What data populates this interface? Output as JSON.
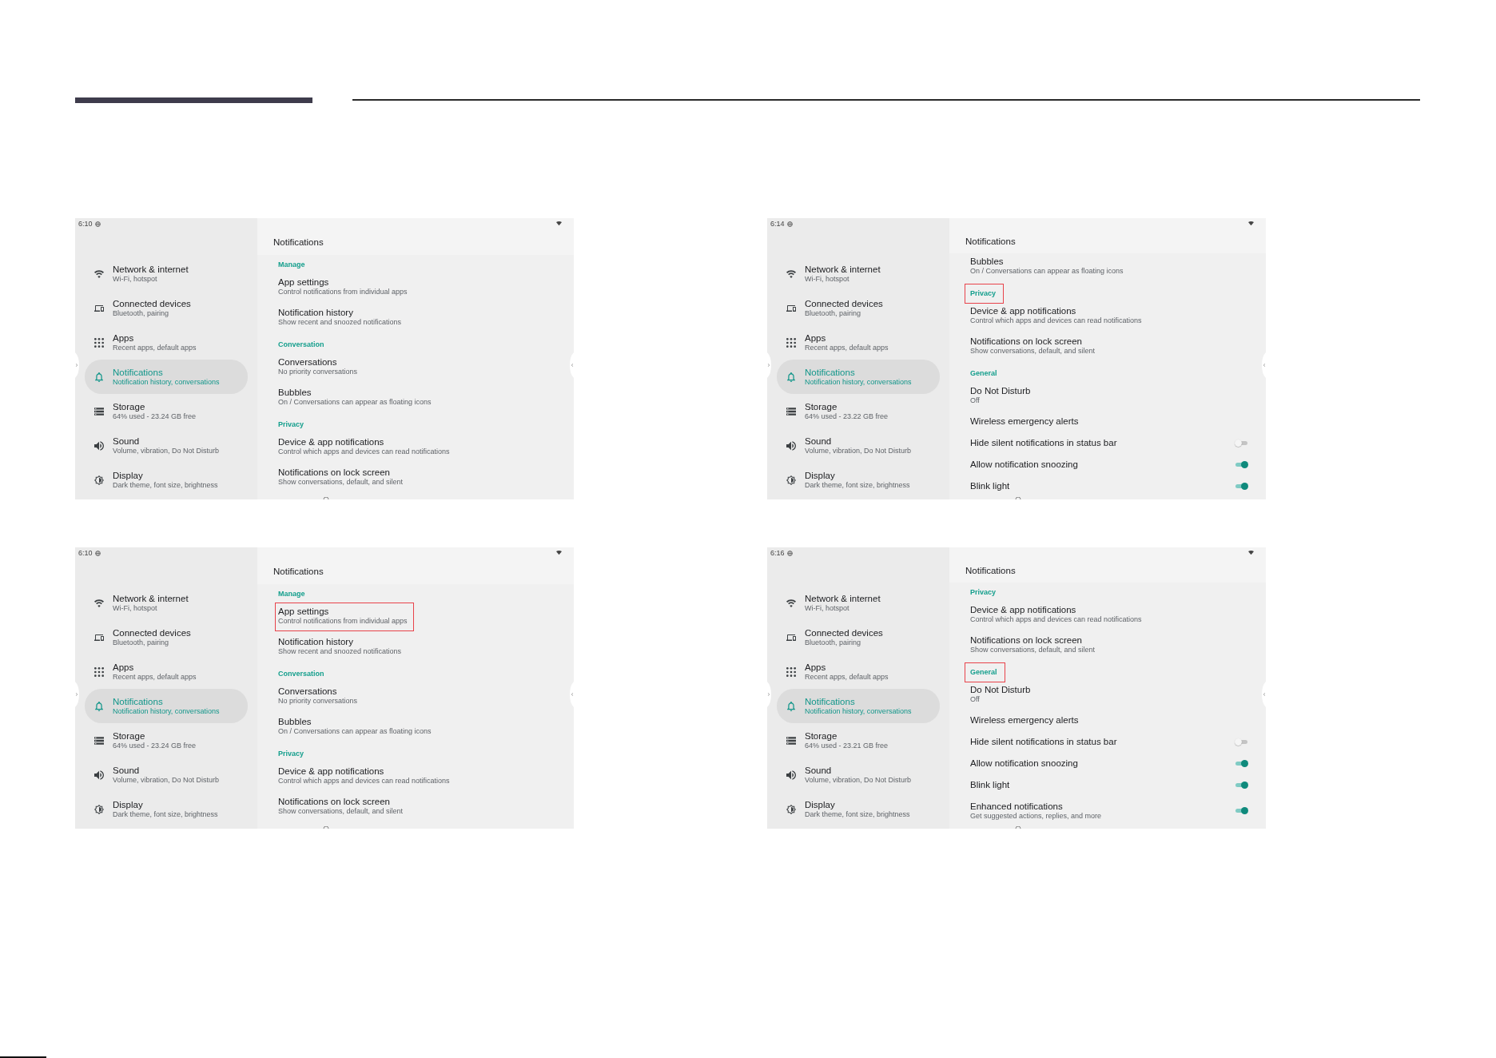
{
  "screens": [
    {
      "status_bar": {
        "time": "6:10"
      },
      "sidebar": {
        "items": [
          {
            "title": "Network & internet",
            "subtitle": "Wi-Fi, hotspot",
            "selected": false
          },
          {
            "title": "Connected devices",
            "subtitle": "Bluetooth, pairing",
            "selected": false
          },
          {
            "title": "Apps",
            "subtitle": "Recent apps, default apps",
            "selected": false
          },
          {
            "title": "Notifications",
            "subtitle": "Notification history, conversations",
            "selected": true
          },
          {
            "title": "Storage",
            "subtitle": "64% used - 23.24 GB free",
            "selected": false
          },
          {
            "title": "Sound",
            "subtitle": "Volume, vibration, Do Not Disturb",
            "selected": false
          },
          {
            "title": "Display",
            "subtitle": "Dark theme, font size, brightness",
            "selected": false
          }
        ]
      },
      "page": {
        "title": "Notifications",
        "rows": [
          {
            "kind": "section",
            "title": "Manage",
            "highlighted": false
          },
          {
            "kind": "item",
            "title": "App settings",
            "subtitle": "Control notifications from individual apps",
            "highlighted": false
          },
          {
            "kind": "item",
            "title": "Notification history",
            "subtitle": "Show recent and snoozed notifications",
            "highlighted": false
          },
          {
            "kind": "section",
            "title": "Conversation",
            "highlighted": false
          },
          {
            "kind": "item",
            "title": "Conversations",
            "subtitle": "No priority conversations",
            "highlighted": false
          },
          {
            "kind": "item",
            "title": "Bubbles",
            "subtitle": "On / Conversations can appear as floating icons",
            "highlighted": false
          },
          {
            "kind": "section",
            "title": "Privacy",
            "highlighted": false
          },
          {
            "kind": "item",
            "title": "Device & app notifications",
            "subtitle": "Control which apps and devices can read notifications",
            "highlighted": false
          },
          {
            "kind": "item",
            "title": "Notifications on lock screen",
            "subtitle": "Show conversations, default, and silent",
            "highlighted": false
          }
        ]
      }
    },
    {
      "status_bar": {
        "time": "6:14"
      },
      "sidebar": {
        "items": [
          {
            "title": "Network & internet",
            "subtitle": "Wi-Fi, hotspot",
            "selected": false
          },
          {
            "title": "Connected devices",
            "subtitle": "Bluetooth, pairing",
            "selected": false
          },
          {
            "title": "Apps",
            "subtitle": "Recent apps, default apps",
            "selected": false
          },
          {
            "title": "Notifications",
            "subtitle": "Notification history, conversations",
            "selected": true
          },
          {
            "title": "Storage",
            "subtitle": "64% used - 23.22 GB free",
            "selected": false
          },
          {
            "title": "Sound",
            "subtitle": "Volume, vibration, Do Not Disturb",
            "selected": false
          },
          {
            "title": "Display",
            "subtitle": "Dark theme, font size, brightness",
            "selected": false
          }
        ]
      },
      "page": {
        "title": "Notifications",
        "rows": [
          {
            "kind": "item",
            "title": "Bubbles",
            "subtitle": "On / Conversations can appear as floating icons",
            "highlighted": false
          },
          {
            "kind": "section",
            "title": "Privacy",
            "highlighted": true
          },
          {
            "kind": "item",
            "title": "Device & app notifications",
            "subtitle": "Control which apps and devices can read notifications",
            "highlighted": false
          },
          {
            "kind": "item",
            "title": "Notifications on lock screen",
            "subtitle": "Show conversations, default, and silent",
            "highlighted": false
          },
          {
            "kind": "section",
            "title": "General",
            "highlighted": false
          },
          {
            "kind": "item",
            "title": "Do Not Disturb",
            "subtitle": "Off",
            "highlighted": false
          },
          {
            "kind": "item",
            "title": "Wireless emergency alerts",
            "highlighted": false
          },
          {
            "kind": "switch",
            "title": "Hide silent notifications in status bar",
            "on": false,
            "highlighted": false
          },
          {
            "kind": "switch",
            "title": "Allow notification snoozing",
            "on": true,
            "highlighted": false
          },
          {
            "kind": "switch",
            "title": "Blink light",
            "on": true,
            "highlighted": false
          }
        ]
      }
    },
    {
      "status_bar": {
        "time": "6:10"
      },
      "sidebar": {
        "items": [
          {
            "title": "Network & internet",
            "subtitle": "Wi-Fi, hotspot",
            "selected": false
          },
          {
            "title": "Connected devices",
            "subtitle": "Bluetooth, pairing",
            "selected": false
          },
          {
            "title": "Apps",
            "subtitle": "Recent apps, default apps",
            "selected": false
          },
          {
            "title": "Notifications",
            "subtitle": "Notification history, conversations",
            "selected": true
          },
          {
            "title": "Storage",
            "subtitle": "64% used - 23.24 GB free",
            "selected": false
          },
          {
            "title": "Sound",
            "subtitle": "Volume, vibration, Do Not Disturb",
            "selected": false
          },
          {
            "title": "Display",
            "subtitle": "Dark theme, font size, brightness",
            "selected": false
          }
        ]
      },
      "page": {
        "title": "Notifications",
        "rows": [
          {
            "kind": "section",
            "title": "Manage",
            "highlighted": false
          },
          {
            "kind": "item",
            "title": "App settings",
            "subtitle": "Control notifications from individual apps",
            "highlighted": true
          },
          {
            "kind": "item",
            "title": "Notification history",
            "subtitle": "Show recent and snoozed notifications",
            "highlighted": false
          },
          {
            "kind": "section",
            "title": "Conversation",
            "highlighted": false
          },
          {
            "kind": "item",
            "title": "Conversations",
            "subtitle": "No priority conversations",
            "highlighted": false
          },
          {
            "kind": "item",
            "title": "Bubbles",
            "subtitle": "On / Conversations can appear as floating icons",
            "highlighted": false
          },
          {
            "kind": "section",
            "title": "Privacy",
            "highlighted": false
          },
          {
            "kind": "item",
            "title": "Device & app notifications",
            "subtitle": "Control which apps and devices can read notifications",
            "highlighted": false
          },
          {
            "kind": "item",
            "title": "Notifications on lock screen",
            "subtitle": "Show conversations, default, and silent",
            "highlighted": false
          }
        ]
      }
    },
    {
      "status_bar": {
        "time": "6:16"
      },
      "sidebar": {
        "items": [
          {
            "title": "Network & internet",
            "subtitle": "Wi-Fi, hotspot",
            "selected": false
          },
          {
            "title": "Connected devices",
            "subtitle": "Bluetooth, pairing",
            "selected": false
          },
          {
            "title": "Apps",
            "subtitle": "Recent apps, default apps",
            "selected": false
          },
          {
            "title": "Notifications",
            "subtitle": "Notification history, conversations",
            "selected": true
          },
          {
            "title": "Storage",
            "subtitle": "64% used - 23.21 GB free",
            "selected": false
          },
          {
            "title": "Sound",
            "subtitle": "Volume, vibration, Do Not Disturb",
            "selected": false
          },
          {
            "title": "Display",
            "subtitle": "Dark theme, font size, brightness",
            "selected": false
          }
        ]
      },
      "page": {
        "title": "Notifications",
        "rows": [
          {
            "kind": "section",
            "title": "Privacy",
            "highlighted": false
          },
          {
            "kind": "item",
            "title": "Device & app notifications",
            "subtitle": "Control which apps and devices can read notifications",
            "highlighted": false
          },
          {
            "kind": "item",
            "title": "Notifications on lock screen",
            "subtitle": "Show conversations, default, and silent",
            "highlighted": false
          },
          {
            "kind": "section",
            "title": "General",
            "highlighted": true
          },
          {
            "kind": "item",
            "title": "Do Not Disturb",
            "subtitle": "Off",
            "highlighted": false
          },
          {
            "kind": "item",
            "title": "Wireless emergency alerts",
            "highlighted": false
          },
          {
            "kind": "switch",
            "title": "Hide silent notifications in status bar",
            "on": false,
            "highlighted": false
          },
          {
            "kind": "switch",
            "title": "Allow notification snoozing",
            "on": true,
            "highlighted": false
          },
          {
            "kind": "switch",
            "title": "Blink light",
            "on": true,
            "highlighted": false
          },
          {
            "kind": "switch",
            "title": "Enhanced notifications",
            "subtitle": "Get suggested actions, replies, and more",
            "on": true,
            "highlighted": false
          }
        ]
      }
    }
  ]
}
